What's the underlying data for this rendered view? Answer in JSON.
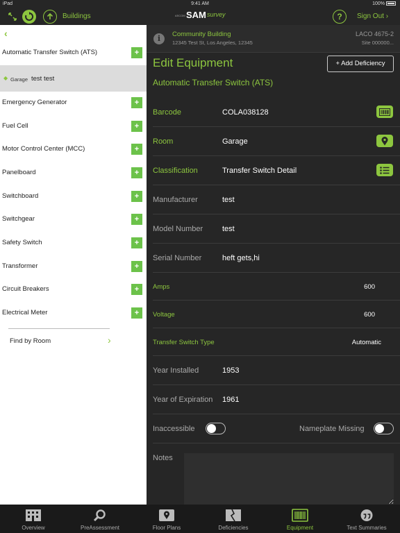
{
  "status": {
    "device": "iPad",
    "time": "9:41 AM",
    "battery": "100%"
  },
  "nav": {
    "buildings": "Buildings",
    "logo_small": "ASCOM",
    "logo_sam": "SAM",
    "logo_survey": "survey",
    "help": "?",
    "sign_out": "Sign Out"
  },
  "sidebar": {
    "items": [
      {
        "label": "Automatic Transfer Switch (ATS)"
      },
      {
        "label": "Emergency Generator"
      },
      {
        "label": "Fuel Cell"
      },
      {
        "label": "Motor Control Center (MCC)"
      },
      {
        "label": "Panelboard"
      },
      {
        "label": "Switchboard"
      },
      {
        "label": "Switchgear"
      },
      {
        "label": "Safety Switch"
      },
      {
        "label": "Transformer"
      },
      {
        "label": "Circuit Breakers"
      },
      {
        "label": "Electrical Meter"
      }
    ],
    "add_label": "+",
    "selected": {
      "room": "Garage",
      "name": "test  test"
    },
    "find_by_room": "Find by Room"
  },
  "building": {
    "name": "Community Building",
    "address": "12345 Test St, Los Angeles, 12345",
    "code": "LACO 4675-2",
    "site": "Site 000000..."
  },
  "main": {
    "title": "Edit Equipment",
    "add_deficiency": "+ Add Deficiency",
    "equipment_type": "Automatic Transfer Switch (ATS)",
    "fields": {
      "barcode": {
        "label": "Barcode",
        "value": "COLA038128"
      },
      "room": {
        "label": "Room",
        "value": "Garage"
      },
      "classification": {
        "label": "Classification",
        "value": "Transfer Switch Detail"
      },
      "manufacturer": {
        "label": "Manufacturer",
        "value": "test"
      },
      "model": {
        "label": "Model Number",
        "value": "test"
      },
      "serial": {
        "label": "Serial Number",
        "value": "heft gets,hi"
      },
      "amps": {
        "label": "Amps",
        "value": "600"
      },
      "voltage": {
        "label": "Voltage",
        "value": "600"
      },
      "ts_type": {
        "label": "Transfer Switch Type",
        "value": "Automatic"
      },
      "year_installed": {
        "label": "Year Installed",
        "value": "1953"
      },
      "year_expiration": {
        "label": "Year of Expiration",
        "value": "1961"
      }
    },
    "inaccessible": {
      "label": "Inaccessible",
      "on": false
    },
    "nameplate_missing": {
      "label": "Nameplate Missing",
      "on": false
    },
    "notes": {
      "label": "Notes",
      "value": ""
    }
  },
  "tabs": [
    {
      "label": "Overview",
      "icon": "building-icon"
    },
    {
      "label": "PreAssessment",
      "icon": "magnifier-icon"
    },
    {
      "label": "Floor Plans",
      "icon": "map-pin-icon"
    },
    {
      "label": "Deficiencies",
      "icon": "cracked-wall-icon"
    },
    {
      "label": "Equipment",
      "icon": "barcode-icon",
      "active": true
    },
    {
      "label": "Text Summaries",
      "icon": "quote-bubble-icon"
    }
  ],
  "colors": {
    "accent": "#8dc63f",
    "add_button": "#6cc24a",
    "panel_dark": "#262626",
    "sidebar_bg": "#ffffff"
  }
}
